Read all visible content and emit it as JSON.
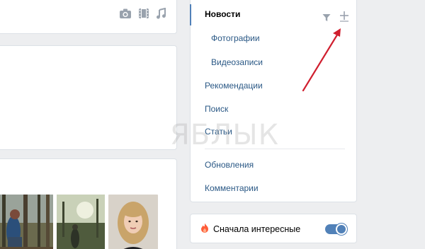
{
  "composer": {
    "icons": [
      "camera-icon",
      "video-icon",
      "music-icon"
    ]
  },
  "menu": {
    "items": [
      {
        "label": "Новости",
        "active": true
      },
      {
        "label": "Фотографии",
        "sub": true
      },
      {
        "label": "Видеозаписи",
        "sub": true
      },
      {
        "label": "Рекомендации"
      },
      {
        "label": "Поиск"
      },
      {
        "label": "Статьи"
      },
      {
        "label": "Обновления"
      },
      {
        "label": "Комментарии"
      }
    ],
    "tools": [
      "filter-icon",
      "plus-icon"
    ]
  },
  "toggle": {
    "label": "Сначала интересные",
    "icon": "fire-icon",
    "on": true
  },
  "watermark": "ЯБЛЫК",
  "colors": {
    "accent": "#5181b8",
    "link": "#2a5885",
    "icon": "#99a2ad",
    "background": "#edeef0",
    "arrow": "#d01f2f",
    "fire": "#ff5c38"
  }
}
